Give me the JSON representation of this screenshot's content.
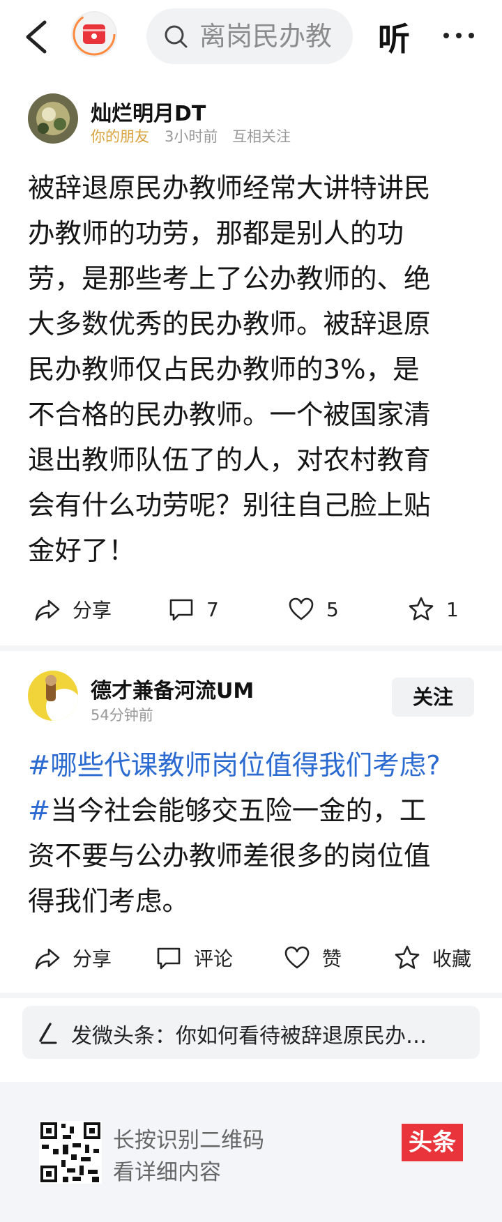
{
  "topbar": {
    "search_text": "离岗民办教",
    "listen_label": "听"
  },
  "post1": {
    "author": "灿烂明月DT",
    "friend_tag": "你的朋友",
    "time": "3小时前",
    "relation": "互相关注",
    "lines": [
      "被辞退原民办教师经常大讲特讲民",
      "办教师的功劳，那都是别人的功",
      "劳，是那些考上了公办教师的、绝",
      "大多数优秀的民办教师。被辞退原",
      "民办教师仅占民办教师的3%，是",
      "不合格的民办教师。一个被国家清",
      "退出教师队伍了的人，对农村教育",
      "会有什么功劳呢？别往自己脸上贴",
      "金好了！"
    ],
    "actions": {
      "share": "分享",
      "comments": "7",
      "likes": "5",
      "favorites": "1"
    }
  },
  "post2": {
    "author": "德才兼备河流UM",
    "time": "54分钟前",
    "follow_label": "关注",
    "hashtag": "#哪些代课教师岗位值得我们考虑?#",
    "hashtag_line1": "#哪些代课教师岗位值得我们考虑?",
    "hash_mark": "#",
    "line2_text": "当今社会能够交五险一金的，工",
    "line3": "资不要与公办教师差很多的岗位值",
    "line4": "得我们考虑。",
    "actions": {
      "share": "分享",
      "comment": "评论",
      "like": "赞",
      "favorite": "收藏"
    }
  },
  "composer": {
    "text": "发微头条：你如何看待被辞退原民办…"
  },
  "footer": {
    "qr_line1": "长按识别二维码",
    "qr_line2": "看详细内容",
    "brand": "头条"
  },
  "colors": {
    "hashtag": "#2b6bd1",
    "friend": "#d9a33e",
    "brand": "#e8343a"
  }
}
